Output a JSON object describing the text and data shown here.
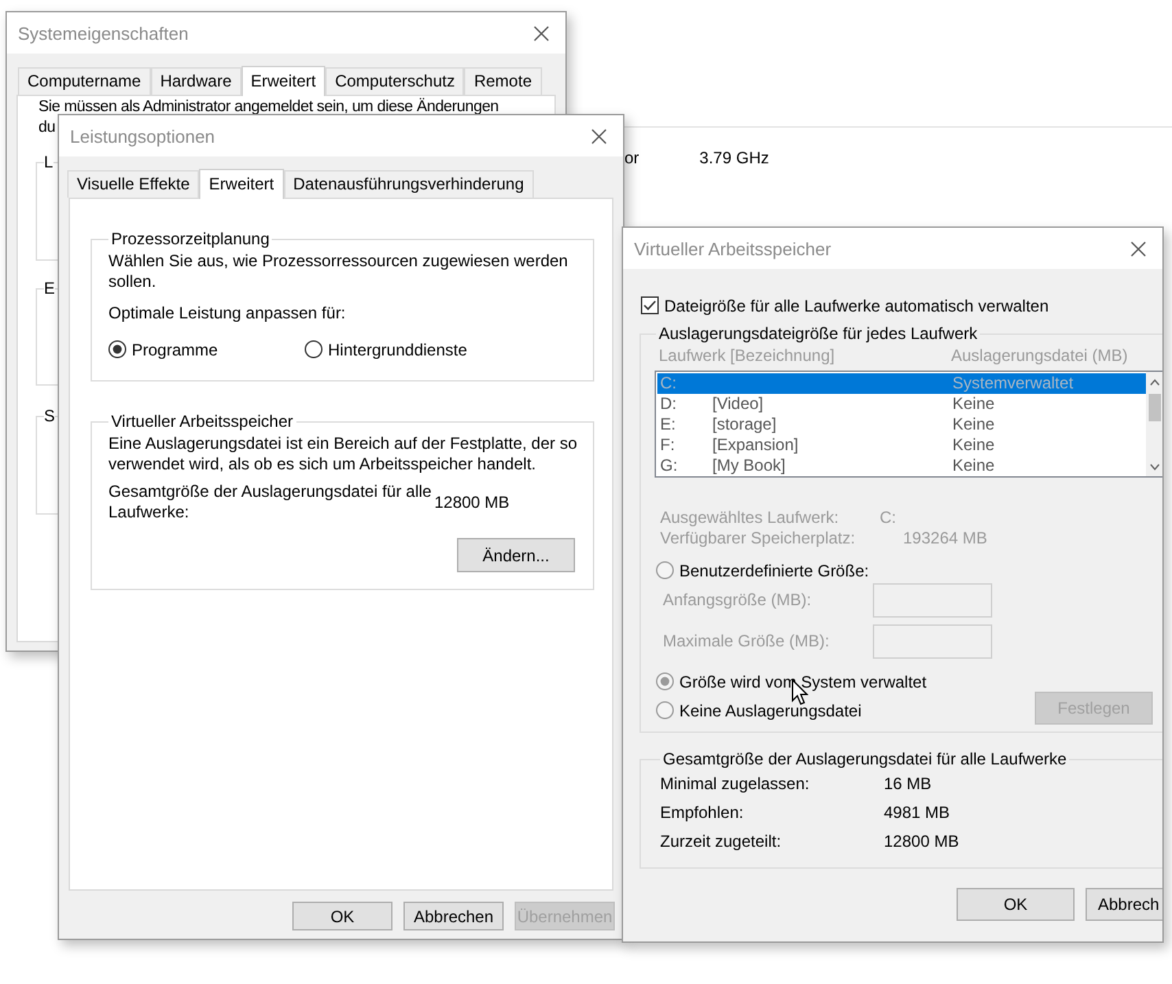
{
  "background": {
    "label_fragment": "or",
    "value": "3.79 GHz"
  },
  "system_properties": {
    "title": "Systemeigenschaften",
    "tabs": [
      {
        "label": "Computername",
        "selected": false
      },
      {
        "label": "Hardware",
        "selected": false
      },
      {
        "label": "Erweitert",
        "selected": true
      },
      {
        "label": "Computerschutz",
        "selected": false
      },
      {
        "label": "Remote",
        "selected": false
      }
    ],
    "notice_lines": [
      "Sie müssen als Administrator angemeldet sein, um diese Änderungen",
      "du"
    ],
    "group_fragments": [
      {
        "label": "L"
      },
      {
        "label": "E"
      },
      {
        "label": "S"
      }
    ]
  },
  "performance_options": {
    "title": "Leistungsoptionen",
    "tabs": [
      {
        "label": "Visuelle Effekte",
        "selected": false
      },
      {
        "label": "Erweitert",
        "selected": true
      },
      {
        "label": "Datenausführungsverhinderung",
        "selected": false
      }
    ],
    "scheduling": {
      "title": "Prozessorzeitplanung",
      "description_lines": [
        "Wählen Sie aus, wie Prozessorressourcen zugewiesen werden",
        "sollen."
      ],
      "prompt": "Optimale Leistung anpassen für:",
      "options": [
        {
          "label": "Programme",
          "selected": true
        },
        {
          "label": "Hintergrunddienste",
          "selected": false
        }
      ]
    },
    "virtual_memory": {
      "title": "Virtueller Arbeitsspeicher",
      "description_lines": [
        "Eine Auslagerungsdatei ist ein Bereich auf der Festplatte, der so",
        "verwendet wird, als ob es sich um Arbeitsspeicher handelt."
      ],
      "total_label_lines": [
        "Gesamtgröße der Auslagerungsdatei für alle",
        "Laufwerke:"
      ],
      "total_value": "12800 MB",
      "change_button": "Ändern..."
    },
    "buttons": [
      {
        "label": "OK",
        "disabled": false
      },
      {
        "label": "Abbrechen",
        "disabled": false
      },
      {
        "label": "Übernehmen",
        "disabled": true
      }
    ]
  },
  "virtual_memory_dialog": {
    "title": "Virtueller Arbeitsspeicher",
    "auto_manage": {
      "label": "Dateigröße für alle Laufwerke automatisch verwalten",
      "checked": true
    },
    "drives": {
      "title": "Auslagerungsdateigröße für jedes Laufwerk",
      "columns": [
        "Laufwerk [Bezeichnung]",
        "Auslagerungsdatei (MB)"
      ],
      "rows": [
        {
          "drive": "C:",
          "paging_file": "Systemverwaltet",
          "selected": true
        },
        {
          "drive": "D:",
          "label": "[Video]",
          "paging_file": "Keine",
          "selected": false
        },
        {
          "drive": "E:",
          "label": "[storage]",
          "paging_file": "Keine",
          "selected": false
        },
        {
          "drive": "F:",
          "label": "[Expansion]",
          "paging_file": "Keine",
          "selected": false
        },
        {
          "drive": "G:",
          "label": "[My Book]",
          "paging_file": "Keine",
          "selected": false
        }
      ],
      "info": [
        {
          "label": "Ausgewähltes Laufwerk:",
          "value": "C:"
        },
        {
          "label": "Verfügbarer Speicherplatz:",
          "value": "193264 MB"
        }
      ],
      "size_options": [
        {
          "label": "Benutzerdefinierte Größe:",
          "selected": false
        },
        {
          "label": "Größe wird vom System verwaltet",
          "selected": true
        },
        {
          "label": "Keine Auslagerungsdatei",
          "selected": false
        }
      ],
      "fields": [
        {
          "label": "Anfangsgröße (MB):"
        },
        {
          "label": "Maximale Größe (MB):"
        }
      ],
      "set_button": {
        "label": "Festlegen",
        "disabled": true
      }
    },
    "totals": {
      "title": "Gesamtgröße der Auslagerungsdatei für alle Laufwerke",
      "rows": [
        {
          "label": "Minimal zugelassen:",
          "value": "16 MB"
        },
        {
          "label": "Empfohlen:",
          "value": "4981 MB"
        },
        {
          "label": "Zurzeit zugeteilt:",
          "value": "12800 MB"
        }
      ]
    },
    "buttons": [
      {
        "label": "OK",
        "disabled": false
      },
      {
        "label": "Abbrech",
        "disabled": false
      }
    ]
  }
}
